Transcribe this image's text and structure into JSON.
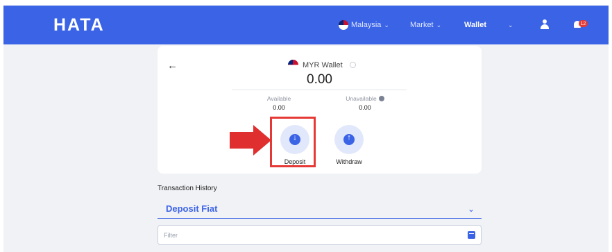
{
  "header": {
    "logo": "HATA",
    "region": "Malaysia",
    "market_label": "Market",
    "wallet_label": "Wallet",
    "notification_count": "12"
  },
  "wallet": {
    "title": "MYR Wallet",
    "balance": "0.00",
    "available_label": "Available",
    "available_value": "0.00",
    "unavailable_label": "Unavailable",
    "unavailable_value": "0.00"
  },
  "actions": {
    "deposit_label": "Deposit",
    "withdraw_label": "Withdraw"
  },
  "transactions": {
    "title": "Transaction History",
    "selected_type": "Deposit Fiat",
    "filter_placeholder": "Filter"
  },
  "colors": {
    "brand_blue": "#3b63e6",
    "highlight_red": "#e53935"
  }
}
